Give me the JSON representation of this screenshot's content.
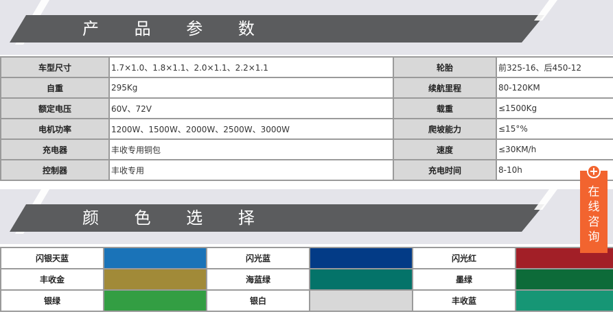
{
  "sections": {
    "params_title": "产 品 参 数",
    "colors_title": "颜 色 选 择"
  },
  "specs": [
    {
      "label": "车型尺寸",
      "value": "1.7×1.0、1.8×1.1、2.0×1.1、2.2×1.1",
      "label2": "轮胎",
      "value2": "前325-16、后450-12"
    },
    {
      "label": "自重",
      "value": "295Kg",
      "label2": "续航里程",
      "value2": "80-120KM"
    },
    {
      "label": "额定电压",
      "value": "60V、72V",
      "label2": "载重",
      "value2": "≤1500Kg"
    },
    {
      "label": "电机功率",
      "value": "1200W、1500W、2000W、2500W、3000W",
      "label2": "爬坡能力",
      "value2": "≤15°%"
    },
    {
      "label": "充电器",
      "value": "丰收专用铜包",
      "label2": "速度",
      "value2": "≤30KM/h"
    },
    {
      "label": "控制器",
      "value": "丰收专用",
      "label2": "充电时间",
      "value2": "8-10h"
    }
  ],
  "colors": [
    [
      {
        "name": "闪银天蓝",
        "hex": "#1a73b8"
      },
      {
        "name": "闪光蓝",
        "hex": "#033b86"
      },
      {
        "name": "闪光红",
        "hex": "#a21f27"
      }
    ],
    [
      {
        "name": "丰收金",
        "hex": "#a18a38"
      },
      {
        "name": "海蓝绿",
        "hex": "#047369"
      },
      {
        "name": "墨绿",
        "hex": "#0d6b39"
      }
    ],
    [
      {
        "name": "银绿",
        "hex": "#339e43"
      },
      {
        "name": "银白",
        "hex": "#d8d8d8"
      },
      {
        "name": "丰收蓝",
        "hex": "#169675"
      }
    ]
  ],
  "chat": {
    "icon": "plus-icon",
    "text": "在线咨询",
    "color": "#f2642f"
  }
}
